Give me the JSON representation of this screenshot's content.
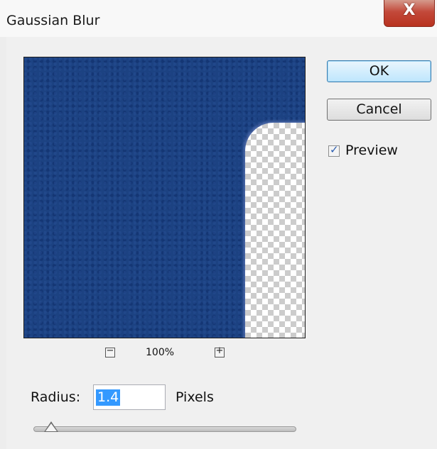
{
  "window": {
    "title": "Gaussian Blur",
    "close_glyph": "X"
  },
  "buttons": {
    "ok_label": "OK",
    "cancel_label": "Cancel"
  },
  "preview_option": {
    "label": "Preview",
    "checked": true
  },
  "zoom": {
    "minus_glyph": "−",
    "level": "100%",
    "plus_glyph": "+"
  },
  "radius": {
    "label": "Radius:",
    "value": "1.4",
    "units": "Pixels",
    "slider_fraction": 0.06
  },
  "colors": {
    "preview_blue": "#1c4282",
    "selection": "#3399ff",
    "close_red": "#c3493a"
  },
  "icons": {
    "zoom_out": "zoom-out-icon",
    "zoom_in": "zoom-in-icon",
    "close": "close-icon",
    "checkmark": "checkmark-icon"
  }
}
